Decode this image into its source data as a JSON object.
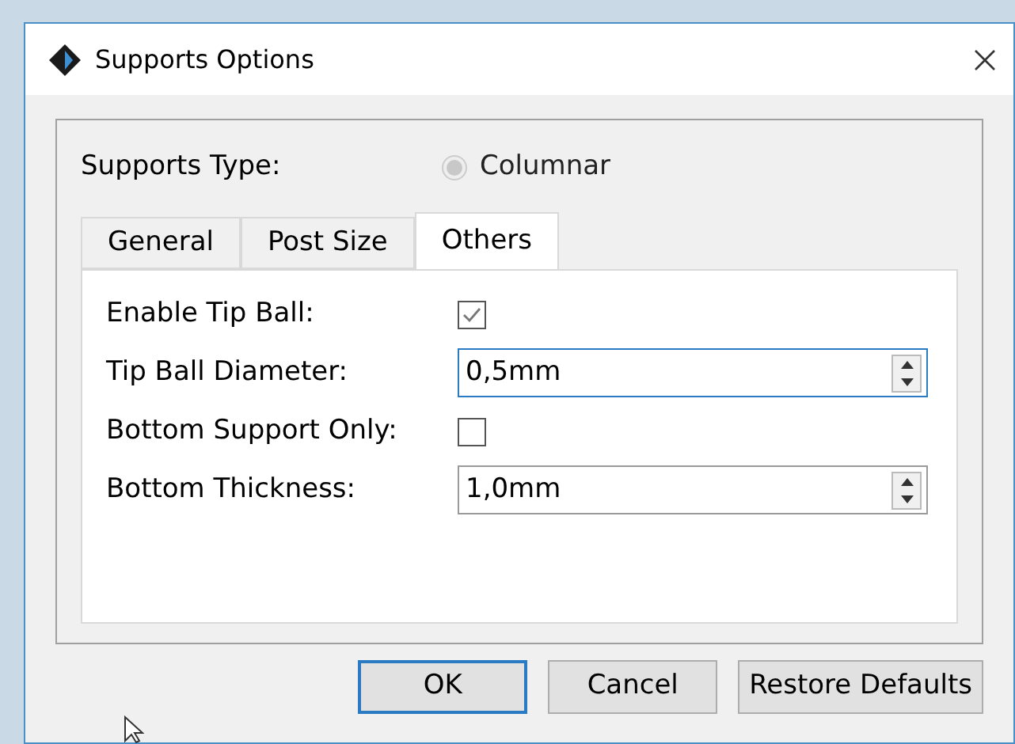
{
  "window": {
    "title": "Supports Options"
  },
  "supports_type": {
    "label": "Supports Type:",
    "option": {
      "label": "Columnar",
      "selected": true,
      "disabled": true
    }
  },
  "tabs": [
    {
      "label": "General",
      "selected": false
    },
    {
      "label": "Post Size",
      "selected": false
    },
    {
      "label": "Others",
      "selected": true
    }
  ],
  "fields": [
    {
      "kind": "checkbox",
      "label": "Enable Tip Ball:",
      "checked": true
    },
    {
      "kind": "spinbox",
      "label": "Tip Ball Diameter:",
      "value": "0,5mm",
      "focused": true
    },
    {
      "kind": "checkbox",
      "label": "Bottom Support Only:",
      "checked": false
    },
    {
      "kind": "spinbox",
      "label": "Bottom Thickness:",
      "value": "1,0mm",
      "focused": false
    }
  ],
  "buttons": [
    {
      "label": "OK",
      "default": true
    },
    {
      "label": "Cancel",
      "default": false
    },
    {
      "label": "Restore Defaults",
      "default": false
    }
  ]
}
